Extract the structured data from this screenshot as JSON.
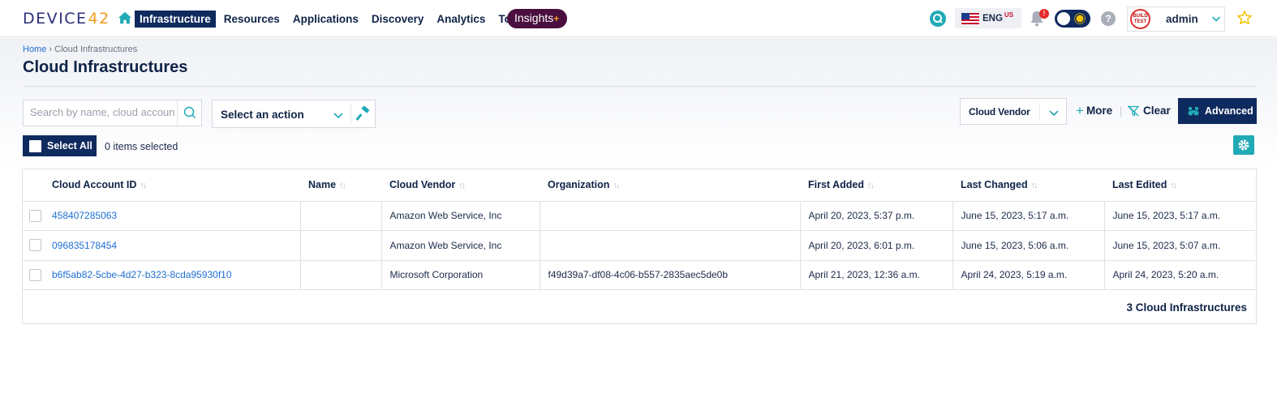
{
  "app": {
    "logo_text": "DEVICE",
    "logo_num": "42"
  },
  "nav": {
    "items": [
      {
        "label": "Infrastructure"
      },
      {
        "label": "Resources"
      },
      {
        "label": "Applications"
      },
      {
        "label": "Discovery"
      },
      {
        "label": "Analytics"
      },
      {
        "label": "Tools"
      }
    ],
    "active_index": 0,
    "insights_label": "Insights",
    "insights_plus": "+"
  },
  "header_right": {
    "language": "ENG",
    "region": "US",
    "notification_badge": "!",
    "help_glyph": "?",
    "avatar_text": "BUILD TEST",
    "username": "admin"
  },
  "breadcrumb": {
    "home": "Home",
    "separator": "›",
    "current": "Cloud Infrastructures"
  },
  "page_title": "Cloud Infrastructures",
  "toolbar": {
    "search_placeholder": "Search by name, cloud account",
    "action_label": "Select an action",
    "vendor_filter_label": "Cloud Vendor",
    "more_label": "More",
    "clear_label": "Clear",
    "advanced_label": "Advanced",
    "select_all_label": "Select All",
    "items_selected": "0 items selected"
  },
  "table": {
    "columns": [
      "Cloud Account ID",
      "Name",
      "Cloud Vendor",
      "Organization",
      "First Added",
      "Last Changed",
      "Last Edited"
    ],
    "rows": [
      {
        "account_id": "458407285063",
        "name": "",
        "vendor": "Amazon Web Service, Inc",
        "organization": "",
        "first_added": "April 20, 2023, 5:37 p.m.",
        "last_changed": "June 15, 2023, 5:17 a.m.",
        "last_edited": "June 15, 2023, 5:17 a.m."
      },
      {
        "account_id": "096835178454",
        "name": "",
        "vendor": "Amazon Web Service, Inc",
        "organization": "",
        "first_added": "April 20, 2023, 6:01 p.m.",
        "last_changed": "June 15, 2023, 5:06 a.m.",
        "last_edited": "June 15, 2023, 5:07 a.m."
      },
      {
        "account_id": "b6f5ab82-5cbe-4d27-b323-8cda95930f10",
        "name": "",
        "vendor": "Microsoft Corporation",
        "organization": "f49d39a7-df08-4c06-b557-2835aec5de0b",
        "first_added": "April 21, 2023, 12:36 a.m.",
        "last_changed": "April 24, 2023, 5:19 a.m.",
        "last_edited": "April 24, 2023, 5:20 a.m."
      }
    ],
    "footer": "3 Cloud Infrastructures"
  },
  "colors": {
    "primary": "#0f2a5e",
    "accent": "#20aab6",
    "link": "#1f6fd1",
    "insights": "#4a0f3e",
    "logo_orange": "#f39a1e"
  },
  "icons": {
    "home": "home-icon",
    "search": "search-icon",
    "bell": "bell-icon",
    "theme_toggle": "theme-toggle-icon",
    "help": "help-icon",
    "star": "star-icon",
    "hammer": "hammer-icon",
    "filter_clear": "filter-clear-icon",
    "binoculars": "binoculars-icon",
    "gear": "gear-icon",
    "chevron": "chevron-down-icon"
  }
}
